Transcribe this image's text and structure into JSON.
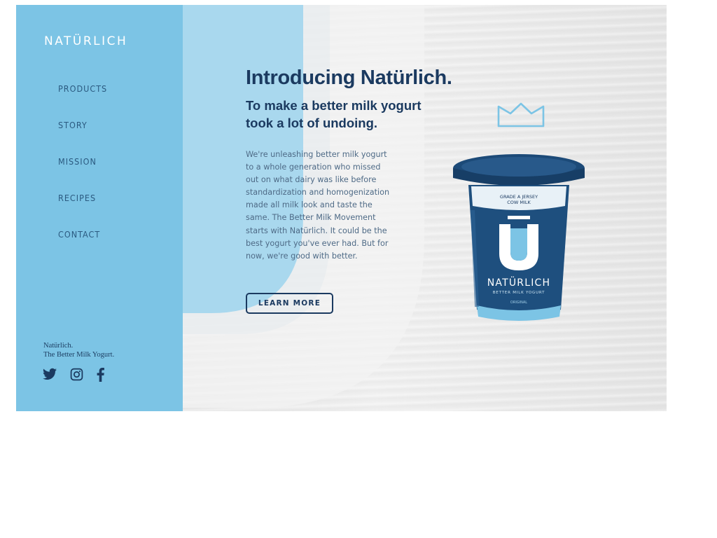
{
  "brand": {
    "logo": "NATÜRLICH"
  },
  "nav": {
    "items": [
      "PRODUCTS",
      "STORY",
      "MISSION",
      "RECIPES",
      "CONTACT"
    ]
  },
  "tagline": {
    "line1": "Natürlich.",
    "line2": "The Better Milk Yogurt."
  },
  "social": {
    "icons": [
      "twitter-icon",
      "instagram-icon",
      "facebook-icon"
    ]
  },
  "hero": {
    "headline": "Introducing Natürlich.",
    "subhead": "To make a better milk yogurt took a lot of undoing.",
    "body": "We're unleashing better milk yogurt to a whole generation who missed out on what dairy was like before standardization and homogenization made all milk look and taste the same. The Better Milk Movement starts with Natürlich. It could be the best yogurt you've ever had. But for now, we're good with better.",
    "cta": "LEARN MORE"
  },
  "product": {
    "label_top": "GRADE A JERSEY COW MILK",
    "name": "NATÜRLICH",
    "sub": "BETTER MILK YOGURT",
    "flavor": "ORIGINAL"
  },
  "colors": {
    "sidebar": "#7cc4e5",
    "navy": "#1b3a60",
    "accent_light": "#a9d8ee"
  }
}
